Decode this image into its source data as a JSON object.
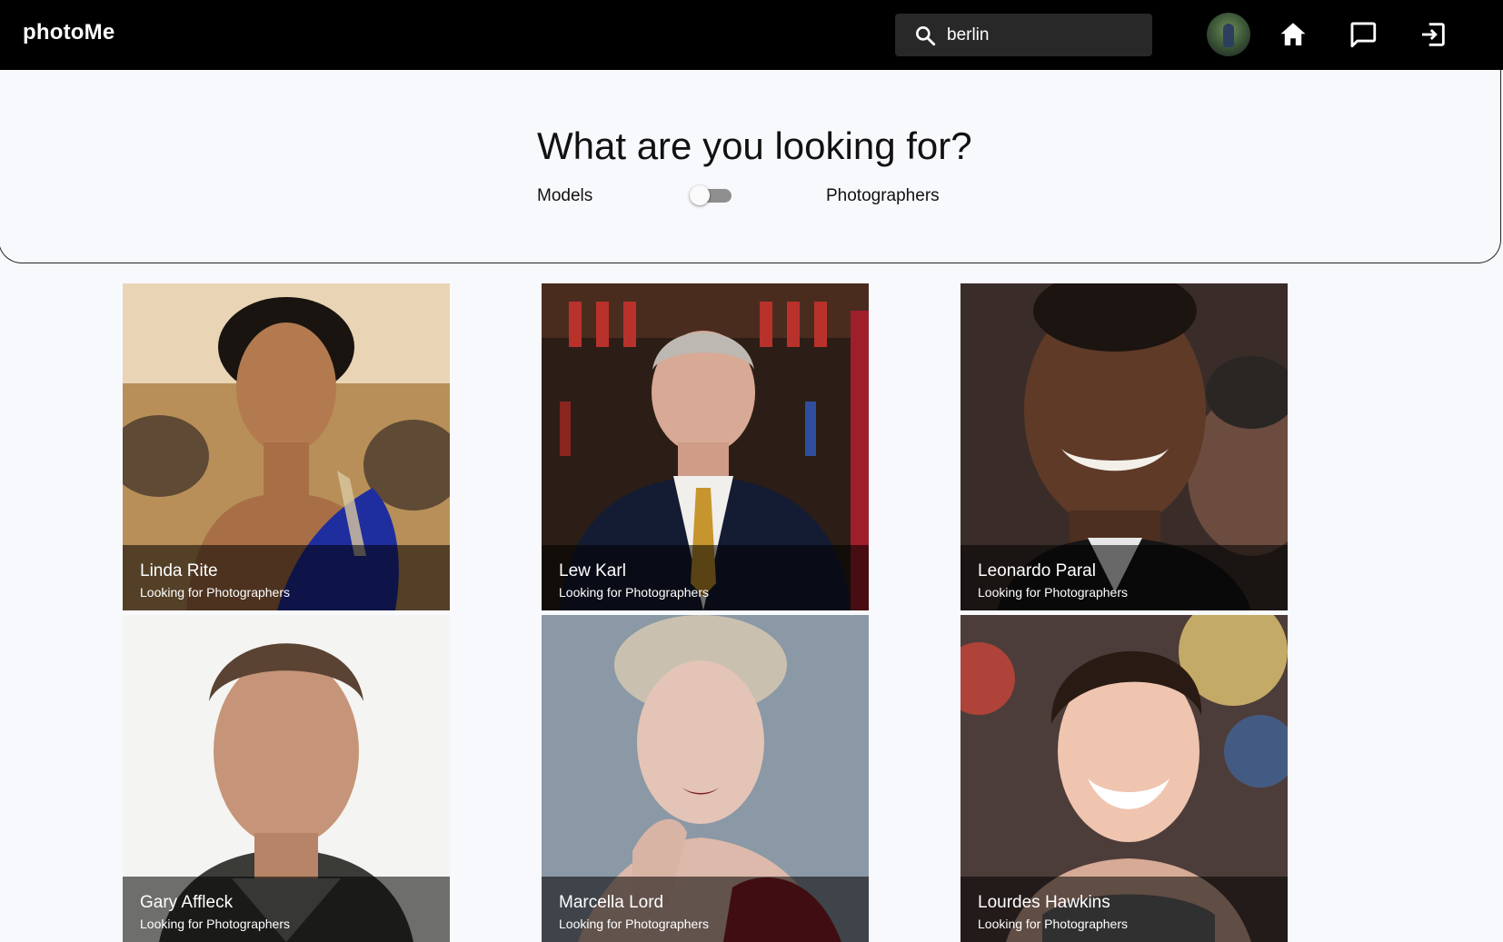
{
  "header": {
    "brand": "photoMe",
    "search": {
      "value": "berlin",
      "icon": "search-icon"
    },
    "avatar_icon": "user-avatar",
    "nav_icons": [
      "home-icon",
      "chat-icon",
      "logout-icon"
    ]
  },
  "filter": {
    "title": "What are you looking for?",
    "left_label": "Models",
    "right_label": "Photographers",
    "toggle_on": false
  },
  "profiles": [
    {
      "name": "Linda Rite",
      "subtitle": "Looking for Photographers"
    },
    {
      "name": "Lew Karl",
      "subtitle": "Looking for Photographers"
    },
    {
      "name": "Leonardo Paral",
      "subtitle": "Looking for Photographers"
    },
    {
      "name": "Gary Affleck",
      "subtitle": "Looking for Photographers"
    },
    {
      "name": "Marcella Lord",
      "subtitle": "Looking for Photographers"
    },
    {
      "name": "Lourdes Hawkins",
      "subtitle": "Looking for Photographers"
    }
  ],
  "colors": {
    "header_bg": "#000000",
    "page_bg": "#f8f9fd",
    "search_bg": "#282828",
    "toggle_track": "#8f8f8f"
  }
}
